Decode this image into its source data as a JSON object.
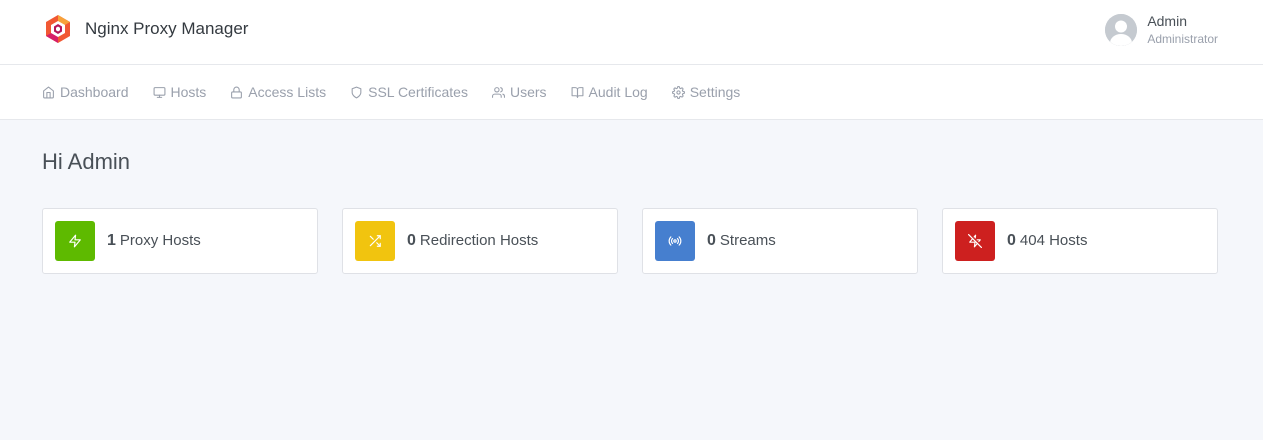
{
  "header": {
    "brand_name": "Nginx Proxy Manager",
    "user_name": "Admin",
    "user_role": "Administrator"
  },
  "nav": {
    "items": [
      {
        "label": "Dashboard",
        "icon": "home-icon"
      },
      {
        "label": "Hosts",
        "icon": "monitor-icon"
      },
      {
        "label": "Access Lists",
        "icon": "lock-icon"
      },
      {
        "label": "SSL Certificates",
        "icon": "shield-icon"
      },
      {
        "label": "Users",
        "icon": "users-icon"
      },
      {
        "label": "Audit Log",
        "icon": "book-icon"
      },
      {
        "label": "Settings",
        "icon": "settings-icon"
      }
    ]
  },
  "main": {
    "greeting": "Hi Admin",
    "stats": [
      {
        "count": "1",
        "label": "Proxy Hosts",
        "icon": "zap-icon",
        "color": "#5eba00"
      },
      {
        "count": "0",
        "label": "Redirection Hosts",
        "icon": "shuffle-icon",
        "color": "#f1c40f"
      },
      {
        "count": "0",
        "label": "Streams",
        "icon": "radio-icon",
        "color": "#467fcf"
      },
      {
        "count": "0",
        "label": "404 Hosts",
        "icon": "zap-off-icon",
        "color": "#cd201f"
      }
    ]
  },
  "colors": {
    "background": "#f5f7fb",
    "logo_accent": "#f15833"
  }
}
